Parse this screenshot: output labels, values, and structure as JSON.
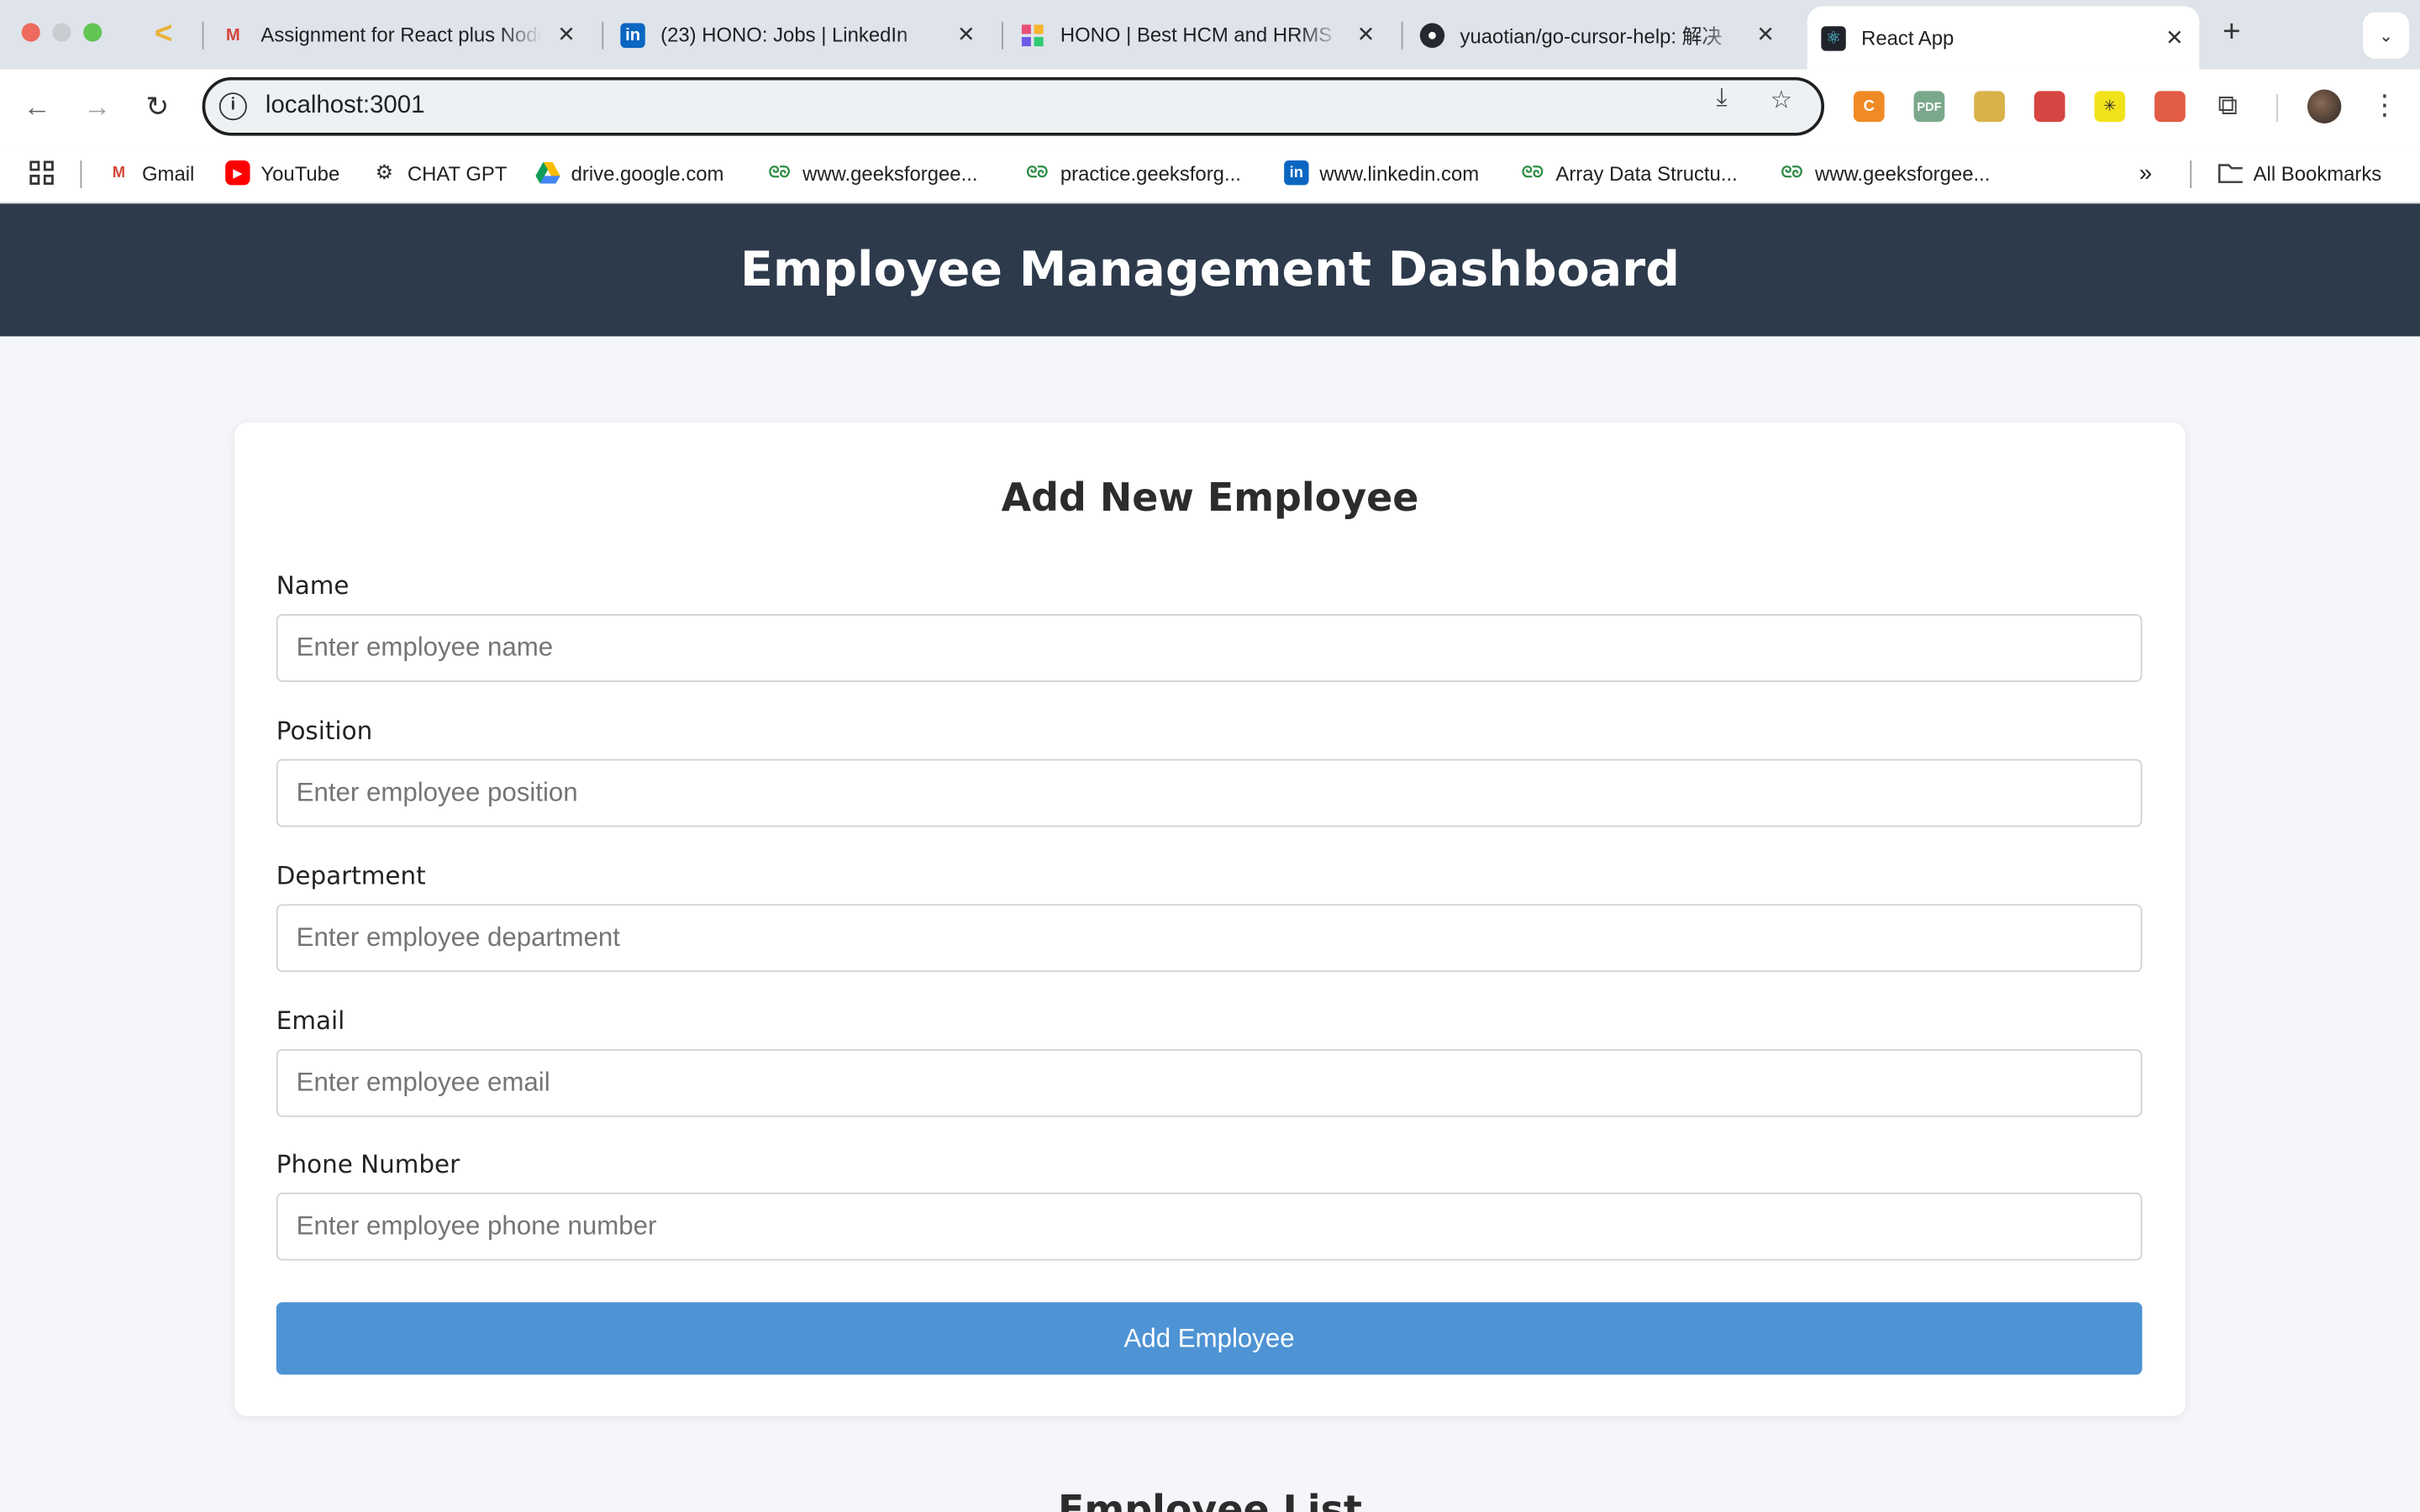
{
  "browser": {
    "tabs": [
      {
        "title": "Assignment for React plus Node",
        "favicon": "gmail-icon"
      },
      {
        "title": "(23) HONO: Jobs | LinkedIn",
        "favicon": "linkedin-icon"
      },
      {
        "title": "HONO | Best HCM and HRMS",
        "favicon": "hono-icon"
      },
      {
        "title": "yuaotian/go-cursor-help: 解决",
        "favicon": "github-icon"
      },
      {
        "title": "React App",
        "favicon": "react-icon",
        "active": true
      }
    ],
    "new_tab": "+",
    "address": "localhost:3001",
    "bookmarks": [
      {
        "label": "Gmail",
        "icon": "gmail-icon"
      },
      {
        "label": "YouTube",
        "icon": "youtube-icon"
      },
      {
        "label": "CHAT GPT",
        "icon": "openai-icon"
      },
      {
        "label": "drive.google.com",
        "icon": "drive-icon"
      },
      {
        "label": "www.geeksforgee...",
        "icon": "gfg-icon"
      },
      {
        "label": "practice.geeksforg...",
        "icon": "gfg-icon"
      },
      {
        "label": "www.linkedin.com",
        "icon": "linkedin-icon"
      },
      {
        "label": "Array Data Structu...",
        "icon": "gfg-icon"
      },
      {
        "label": "www.geeksforgee...",
        "icon": "gfg-icon"
      }
    ],
    "all_bookmarks": "All Bookmarks",
    "extensions": [
      {
        "name": "c-extension-icon",
        "label": "C",
        "color": "#f08a24"
      },
      {
        "name": "pdf-extension-icon",
        "label": "PDF",
        "color": "#7aa88a"
      },
      {
        "name": "person-extension-icon",
        "label": "",
        "color": "#d9b24a"
      },
      {
        "name": "red-extension-icon",
        "label": "",
        "color": "#d64541"
      },
      {
        "name": "yellow-extension-icon",
        "label": "✳",
        "color": "#f2e21b"
      },
      {
        "name": "record-extension-icon",
        "label": "",
        "color": "#e25b45"
      }
    ]
  },
  "page": {
    "header_title": "Employee Management Dashboard",
    "form": {
      "title": "Add New Employee",
      "fields": [
        {
          "label": "Name",
          "placeholder": "Enter employee name"
        },
        {
          "label": "Position",
          "placeholder": "Enter employee position"
        },
        {
          "label": "Department",
          "placeholder": "Enter employee department"
        },
        {
          "label": "Email",
          "placeholder": "Enter employee email"
        },
        {
          "label": "Phone Number",
          "placeholder": "Enter employee phone number"
        }
      ],
      "submit_label": "Add Employee"
    },
    "list_title": "Employee List"
  },
  "colors": {
    "header_bg": "#2c3a4b",
    "button_bg": "#4e93d4",
    "page_bg": "#f4f6f9"
  }
}
